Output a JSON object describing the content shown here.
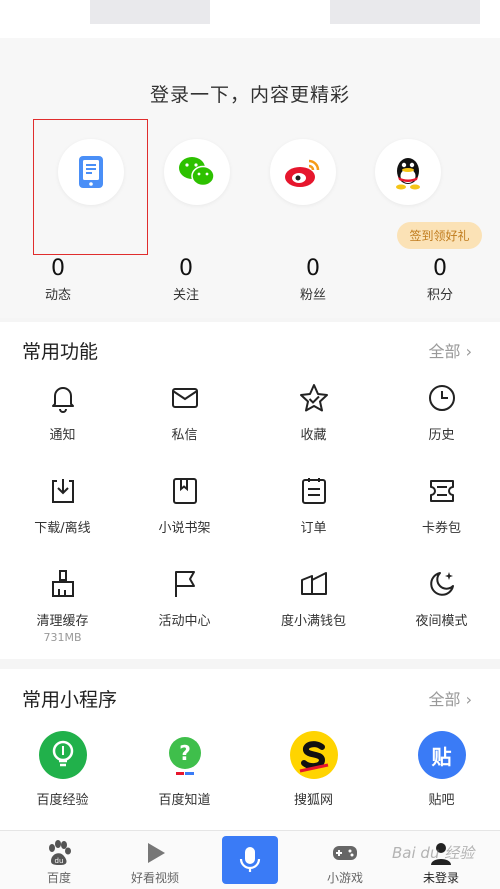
{
  "login": {
    "title": "登录一下，内容更精彩",
    "badge": "签到领好礼",
    "stats": [
      {
        "value": "0",
        "label": "动态"
      },
      {
        "value": "0",
        "label": "关注"
      },
      {
        "value": "0",
        "label": "粉丝"
      },
      {
        "value": "0",
        "label": "积分"
      }
    ]
  },
  "common_functions": {
    "title": "常用功能",
    "all": "全部",
    "items": [
      {
        "label": "通知",
        "icon": "bell-icon"
      },
      {
        "label": "私信",
        "icon": "mail-icon"
      },
      {
        "label": "收藏",
        "icon": "star-icon"
      },
      {
        "label": "历史",
        "icon": "clock-icon"
      },
      {
        "label": "下载/离线",
        "icon": "download-icon"
      },
      {
        "label": "小说书架",
        "icon": "bookmark-icon"
      },
      {
        "label": "订单",
        "icon": "order-icon"
      },
      {
        "label": "卡券包",
        "icon": "coupon-icon"
      },
      {
        "label": "清理缓存",
        "sub": "731MB",
        "icon": "broom-icon"
      },
      {
        "label": "活动中心",
        "icon": "flag-icon"
      },
      {
        "label": "度小满钱包",
        "icon": "wallet-icon"
      },
      {
        "label": "夜间模式",
        "icon": "moon-icon"
      }
    ]
  },
  "mini_programs": {
    "title": "常用小程序",
    "all": "全部",
    "items": [
      {
        "label": "百度经验",
        "icon": "baidu-jingyan-icon"
      },
      {
        "label": "百度知道",
        "icon": "baidu-zhidao-icon"
      },
      {
        "label": "搜狐网",
        "icon": "sohu-icon"
      },
      {
        "label": "贴吧",
        "icon": "tieba-icon",
        "glyph": "贴"
      }
    ]
  },
  "nav": {
    "items": [
      {
        "label": "百度"
      },
      {
        "label": "好看视频"
      },
      {
        "label": "小游戏"
      },
      {
        "label": "未登录"
      }
    ]
  },
  "watermark": "Bai du 经验",
  "colors": {
    "accent": "#3a7bf6",
    "highlight": "#e02d2d",
    "badge": "#fbe2b6"
  }
}
